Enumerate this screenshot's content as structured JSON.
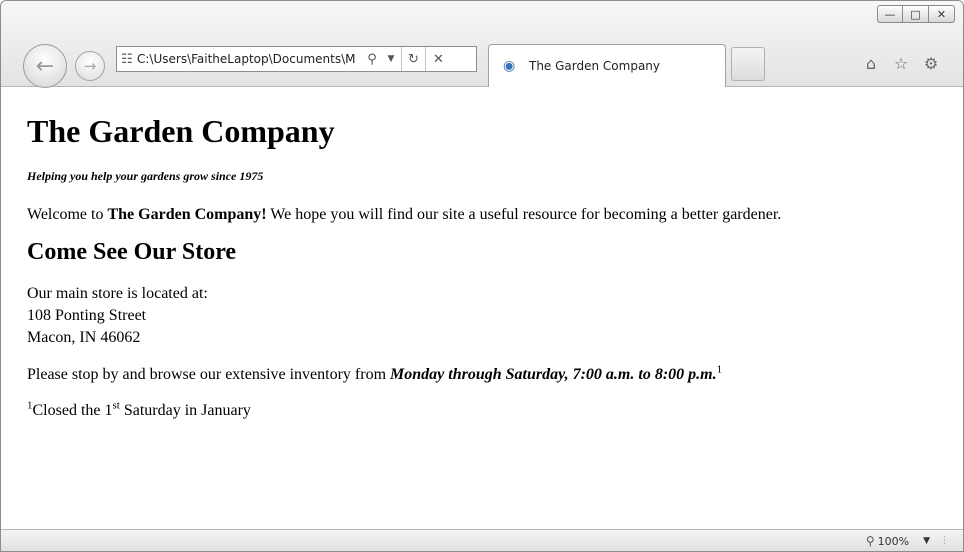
{
  "browser": {
    "address_url": "C:\\Users\\FaitheLaptop\\Documents\\M",
    "tab_title": "The Garden Company",
    "zoom": "100%",
    "icons": {
      "back": "back-arrow-icon",
      "forward": "forward-arrow-icon",
      "page": "page-icon",
      "search": "search-icon",
      "dropdown": "chevron-down-icon",
      "refresh": "refresh-icon",
      "stop": "stop-icon",
      "tab": "ie-logo-icon",
      "home": "home-icon",
      "favorites": "star-icon",
      "tools": "gear-icon",
      "zoom": "magnifier-icon"
    }
  },
  "page": {
    "title": "The Garden Company",
    "tagline": "Helping you help your gardens grow since 1975",
    "welcome": {
      "before": "Welcome to ",
      "bold": "The Garden Company!",
      "after": " We hope you will find our site a useful resource for becoming a better gardener."
    },
    "section_heading": "Come See Our Store",
    "address": {
      "intro": "Our main store is located at:",
      "street": "108 Ponting Street",
      "city": "Macon, IN 46062"
    },
    "hours": {
      "before": "Please stop by and browse our extensive inventory from ",
      "emphasis": "Monday through Saturday, 7:00 a.m. to 8:00 p.m.",
      "footnote_mark": "1"
    },
    "footnote": {
      "mark": "1",
      "text_before": "Closed the 1",
      "ordinal": "st",
      "text_after": " Saturday in January"
    }
  }
}
